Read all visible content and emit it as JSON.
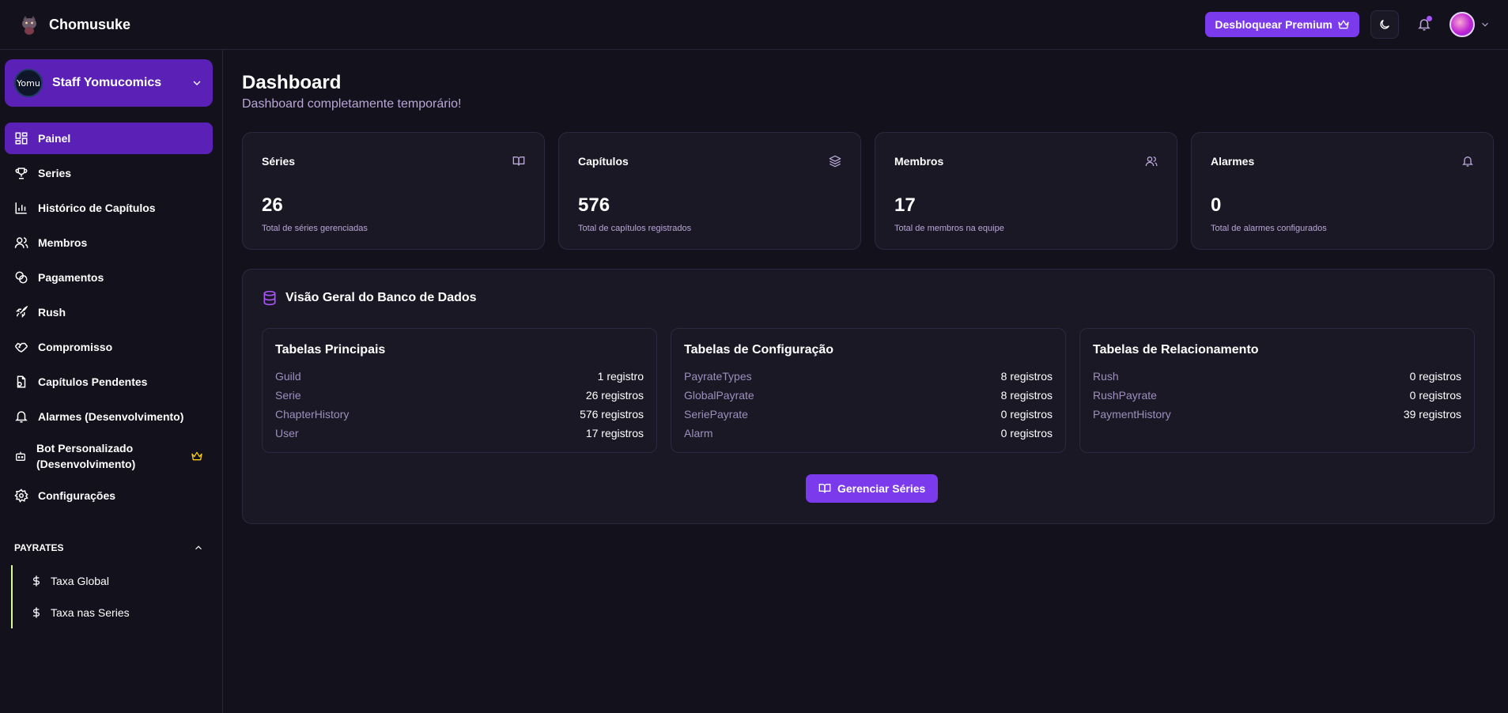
{
  "app": {
    "name": "Chomusuke"
  },
  "header": {
    "premium_label": "Desbloquear Premium",
    "accent": "#7c3aed"
  },
  "sidebar": {
    "guild_avatar_text": "Yomu",
    "guild_name": "Staff Yomucomics",
    "items": [
      {
        "label": "Painel",
        "icon": "dashboard-icon",
        "active": true
      },
      {
        "label": "Series",
        "icon": "trophy-icon"
      },
      {
        "label": "Histórico de Capítulos",
        "icon": "bar-chart-icon"
      },
      {
        "label": "Membros",
        "icon": "users-icon"
      },
      {
        "label": "Pagamentos",
        "icon": "coins-icon"
      },
      {
        "label": "Rush",
        "icon": "rocket-icon"
      },
      {
        "label": "Compromisso",
        "icon": "handshake-icon"
      },
      {
        "label": "Capítulos Pendentes",
        "icon": "file-pending-icon"
      },
      {
        "label": "Alarmes (Desenvolvimento)",
        "icon": "bell-icon"
      },
      {
        "label": "Bot Personalizado (Desenvolvimento)",
        "icon": "bot-icon",
        "badge": "crown-icon"
      },
      {
        "label": "Configurações",
        "icon": "gear-icon"
      }
    ],
    "payrates_heading": "PAYRATES",
    "payrates_items": [
      {
        "label": "Taxa Global",
        "icon": "dollar-icon"
      },
      {
        "label": "Taxa nas Series",
        "icon": "dollar-icon"
      }
    ]
  },
  "main": {
    "title": "Dashboard",
    "subtitle": "Dashboard completamente temporário!",
    "stats": [
      {
        "label": "Séries",
        "value": "26",
        "desc": "Total de séries gerenciadas",
        "icon": "book-icon"
      },
      {
        "label": "Capítulos",
        "value": "576",
        "desc": "Total de capítulos registrados",
        "icon": "layers-icon"
      },
      {
        "label": "Membros",
        "value": "17",
        "desc": "Total de membros na equipe",
        "icon": "users-icon"
      },
      {
        "label": "Alarmes",
        "value": "0",
        "desc": "Total de alarmes configurados",
        "icon": "bell-icon"
      }
    ],
    "db_overview": {
      "title": "Visão Geral do Banco de Dados",
      "tables": [
        {
          "title": "Tabelas Principais",
          "rows": [
            {
              "name": "Guild",
              "count": "1 registro"
            },
            {
              "name": "Serie",
              "count": "26 registros"
            },
            {
              "name": "ChapterHistory",
              "count": "576 registros"
            },
            {
              "name": "User",
              "count": "17 registros"
            }
          ]
        },
        {
          "title": "Tabelas de Configuração",
          "rows": [
            {
              "name": "PayrateTypes",
              "count": "8 registros"
            },
            {
              "name": "GlobalPayrate",
              "count": "8 registros"
            },
            {
              "name": "SeriePayrate",
              "count": "0 registros"
            },
            {
              "name": "Alarm",
              "count": "0 registros"
            }
          ]
        },
        {
          "title": "Tabelas de Relacionamento",
          "rows": [
            {
              "name": "Rush",
              "count": "0 registros"
            },
            {
              "name": "RushPayrate",
              "count": "0 registros"
            },
            {
              "name": "PaymentHistory",
              "count": "39 registros"
            }
          ]
        }
      ],
      "manage_button": "Gerenciar Séries"
    }
  }
}
